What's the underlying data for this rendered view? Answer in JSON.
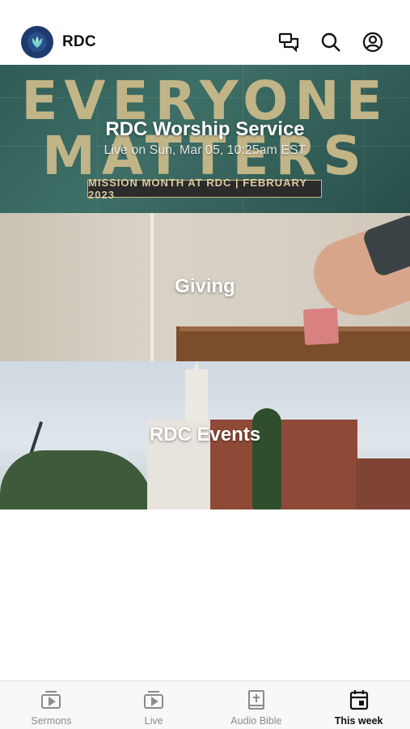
{
  "header": {
    "app_name": "RDC",
    "icons": [
      "chat-icon",
      "search-icon",
      "account-icon"
    ]
  },
  "cards": [
    {
      "title": "RDC Worship Service",
      "subtitle": "Live on Sun, Mar 05, 10:25am EST",
      "image_text": {
        "headline_top": "EVERYONE",
        "headline_bottom": "MATTERS",
        "banner": "MISSION MONTH AT RDC | FEBRUARY 2023"
      }
    },
    {
      "title": "Giving"
    },
    {
      "title": "RDC Events"
    }
  ],
  "tabbar": {
    "tabs": [
      {
        "label": "Sermons",
        "icon": "video-library-icon",
        "active": false
      },
      {
        "label": "Live",
        "icon": "video-library-icon",
        "active": false
      },
      {
        "label": "Audio Bible",
        "icon": "bible-icon",
        "active": false
      },
      {
        "label": "This week",
        "icon": "calendar-icon",
        "active": true
      }
    ]
  },
  "colors": {
    "logo_bg": "#1d3b6e",
    "active_tab": "#111111",
    "inactive_tab": "#8c8c8c"
  }
}
